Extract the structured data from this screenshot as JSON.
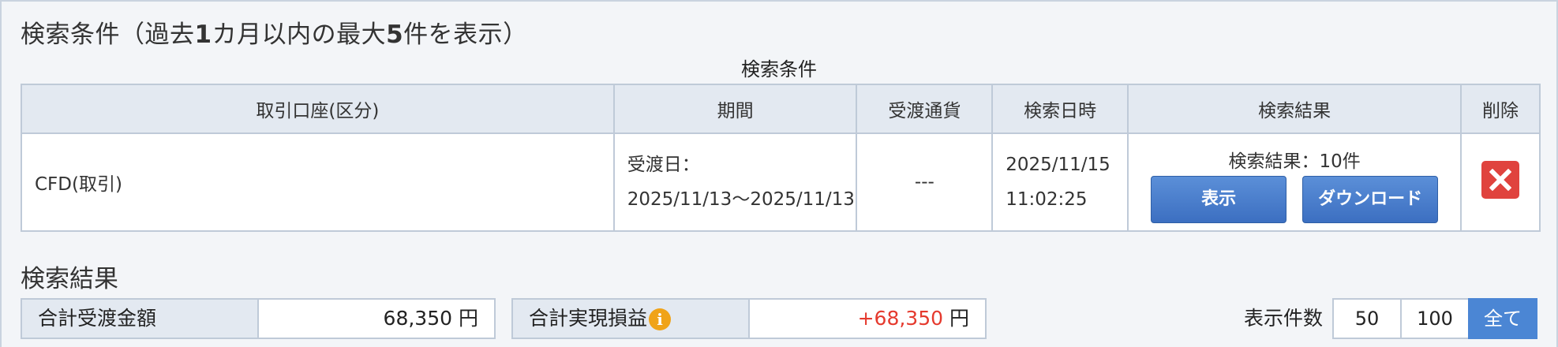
{
  "search_conditions": {
    "heading_prefix": "検索条件（過去",
    "heading_num1": "1",
    "heading_mid": "カ月以内の最大",
    "heading_num2": "5",
    "heading_suffix": "件を表示）",
    "caption": "検索条件",
    "columns": [
      "取引口座(区分)",
      "期間",
      "受渡通貨",
      "検索日時",
      "検索結果",
      "削除"
    ],
    "row": {
      "account": "CFD(取引)",
      "period_label": "受渡日：",
      "period_value": "2025/11/13〜2025/11/13",
      "currency": "---",
      "search_date": "2025/11/15",
      "search_time": "11:02:25",
      "result_text": "検索結果：10件",
      "show_button": "表示",
      "download_button": "ダウンロード"
    }
  },
  "search_results": {
    "heading": "検索結果",
    "total_delivery_label": "合計受渡金額",
    "total_delivery_value": "68,350",
    "total_delivery_unit": "円",
    "total_pl_label": "合計実現損益",
    "total_pl_value": "+68,350",
    "total_pl_unit": "円",
    "info_icon": "info-icon",
    "display_count_label": "表示件数",
    "display_count_options": [
      "50",
      "100",
      "全て"
    ],
    "display_count_selected": "全て"
  },
  "colors": {
    "accent_blue": "#4b86d4",
    "profit_red": "#e53a2e",
    "delete_red": "#e0433e",
    "info_orange": "#f0a318"
  }
}
